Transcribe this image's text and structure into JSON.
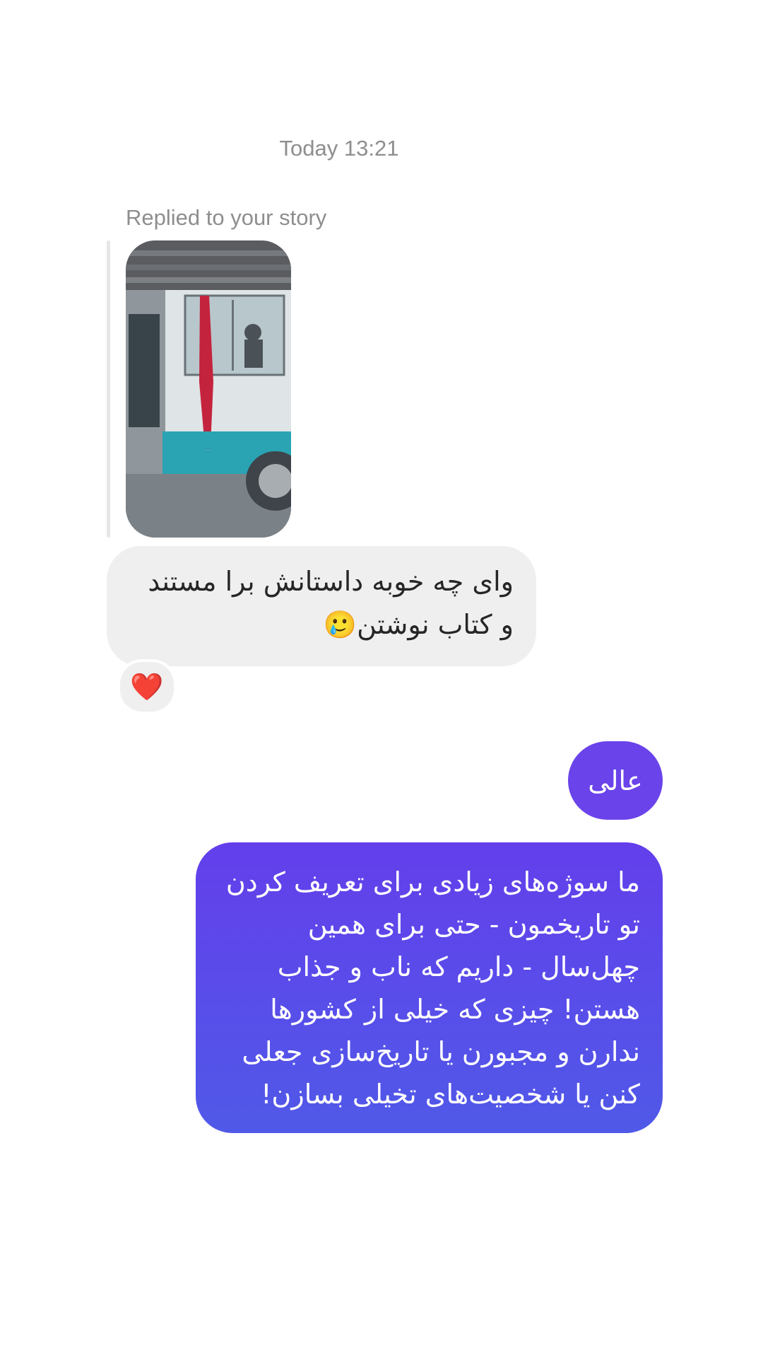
{
  "thread": {
    "timestamp": "Today 13:21",
    "reply_label": "Replied to your story"
  },
  "story": {
    "caption": "...",
    "icon": "story-thumbnail"
  },
  "messages": {
    "incoming": {
      "text": "وای چه خوبه داستانش برا مستند و کتاب نوشتن🥲",
      "reaction": "❤️"
    },
    "outgoing_short": {
      "text": "عالی"
    },
    "outgoing_long": {
      "text": "ما سوژه‌های زیادی برای تعریف کردن تو تاریخمون - حتی برای همین چهل‌سال - داریم که ناب و جذاب هستن! چیزی که خیلی از کشورها ندارن و مجبورن یا تاریخ‌سازی جعلی کنن یا شخصیت‌های تخیلی بسازن!"
    }
  },
  "colors": {
    "incoming_bubble": "#efefef",
    "outgoing_short": "#6a43ea",
    "outgoing_gradient_top": "#633feb",
    "outgoing_gradient_bottom": "#5059e8",
    "meta_text": "#8e8e8e",
    "reaction_heart": "#f03a5f"
  }
}
